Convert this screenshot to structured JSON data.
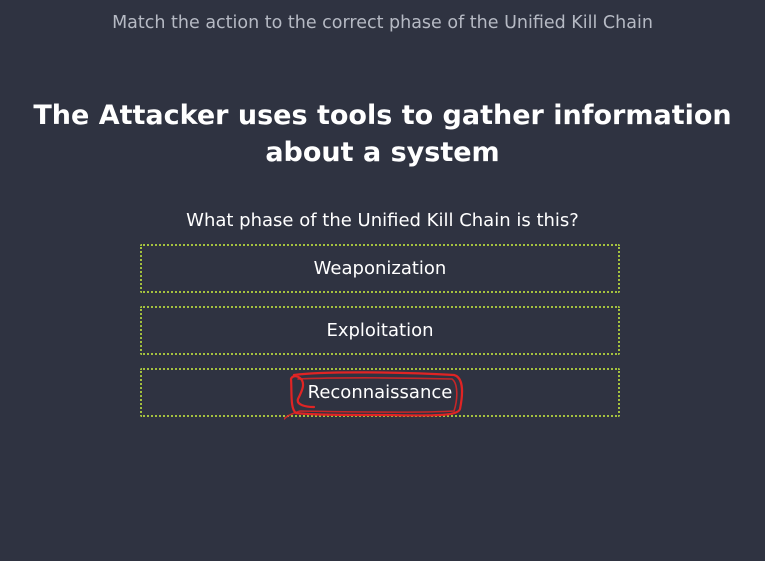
{
  "header": {
    "instruction": "Match the action to the correct phase of the Unified Kill Chain"
  },
  "question": {
    "title": "The Attacker uses tools to gather information about a system",
    "prompt": "What phase of the Unified Kill Chain is this?"
  },
  "options": [
    {
      "label": "Weaponization"
    },
    {
      "label": "Exploitation"
    },
    {
      "label": "Reconnaissance"
    }
  ],
  "colors": {
    "background": "#2f3341",
    "option_border": "#a4c23e",
    "annotation": "#e02424"
  }
}
